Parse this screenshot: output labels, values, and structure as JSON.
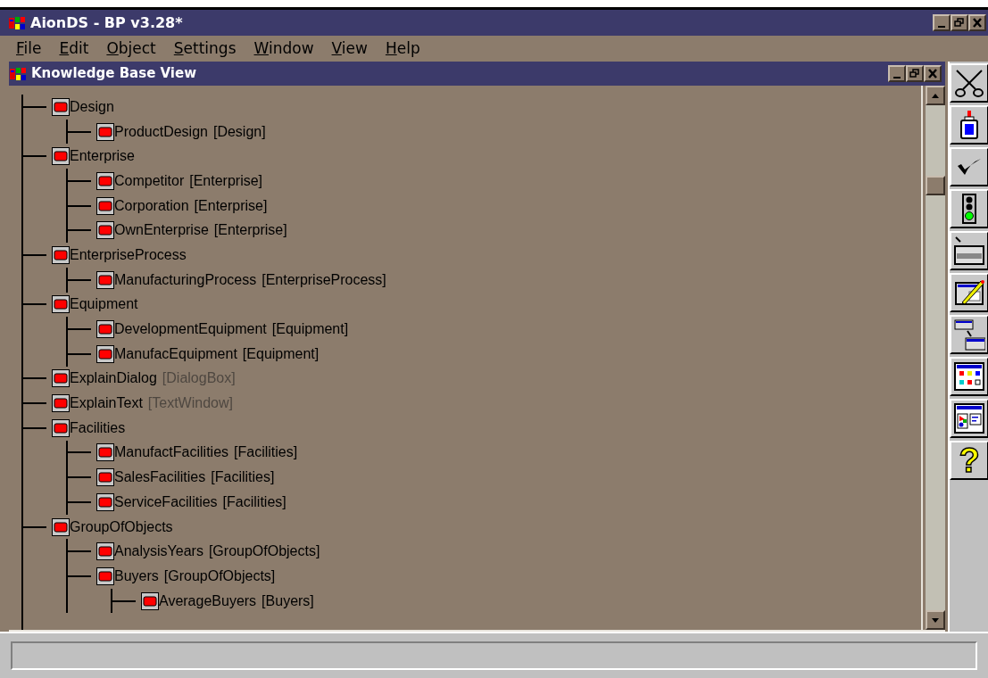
{
  "window": {
    "title": "AionDS - BP v3.28*"
  },
  "menu": [
    "File",
    "Edit",
    "Object",
    "Settings",
    "Window",
    "View",
    "Help"
  ],
  "child_window": {
    "title": "Knowledge Base View"
  },
  "tree": [
    {
      "name": "Design",
      "children": [
        {
          "name": "ProductDesign",
          "class": "[Design]",
          "class_dimmed": false
        }
      ]
    },
    {
      "name": "Enterprise",
      "children": [
        {
          "name": "Competitor",
          "class": "[Enterprise]",
          "class_dimmed": false
        },
        {
          "name": "Corporation",
          "class": "[Enterprise]",
          "class_dimmed": false
        },
        {
          "name": "OwnEnterprise",
          "class": "[Enterprise]",
          "class_dimmed": false
        }
      ]
    },
    {
      "name": "EnterpriseProcess",
      "children": [
        {
          "name": "ManufacturingProcess",
          "class": "[EnterpriseProcess]",
          "class_dimmed": false
        }
      ]
    },
    {
      "name": "Equipment",
      "children": [
        {
          "name": "DevelopmentEquipment",
          "class": "[Equipment]",
          "class_dimmed": false
        },
        {
          "name": "ManufacEquipment",
          "class": "[Equipment]",
          "class_dimmed": false
        }
      ]
    },
    {
      "name": "ExplainDialog",
      "class": "[DialogBox]",
      "class_dimmed": true
    },
    {
      "name": "ExplainText",
      "class": "[TextWindow]",
      "class_dimmed": true
    },
    {
      "name": "Facilities",
      "children": [
        {
          "name": "ManufactFacilities",
          "class": "[Facilities]",
          "class_dimmed": false
        },
        {
          "name": "SalesFacilities",
          "class": "[Facilities]",
          "class_dimmed": false
        },
        {
          "name": "ServiceFacilities",
          "class": "[Facilities]",
          "class_dimmed": false
        }
      ]
    },
    {
      "name": "GroupOfObjects",
      "children": [
        {
          "name": "AnalysisYears",
          "class": "[GroupOfObjects]",
          "class_dimmed": false
        },
        {
          "name": "Buyers",
          "class": "[GroupOfObjects]",
          "class_dimmed": false,
          "children": [
            {
              "name": "AverageBuyers",
              "class": "[Buyers]",
              "class_dimmed": false
            }
          ]
        }
      ]
    }
  ],
  "toolbar": [
    {
      "kind": "scissors"
    },
    {
      "kind": "glue"
    },
    {
      "kind": "check"
    },
    {
      "kind": "traffic"
    },
    {
      "kind": "printer"
    },
    {
      "kind": "form-edit"
    },
    {
      "kind": "form-transfer"
    },
    {
      "kind": "palette"
    },
    {
      "kind": "layout"
    },
    {
      "kind": "help",
      "glyph": "?"
    }
  ]
}
